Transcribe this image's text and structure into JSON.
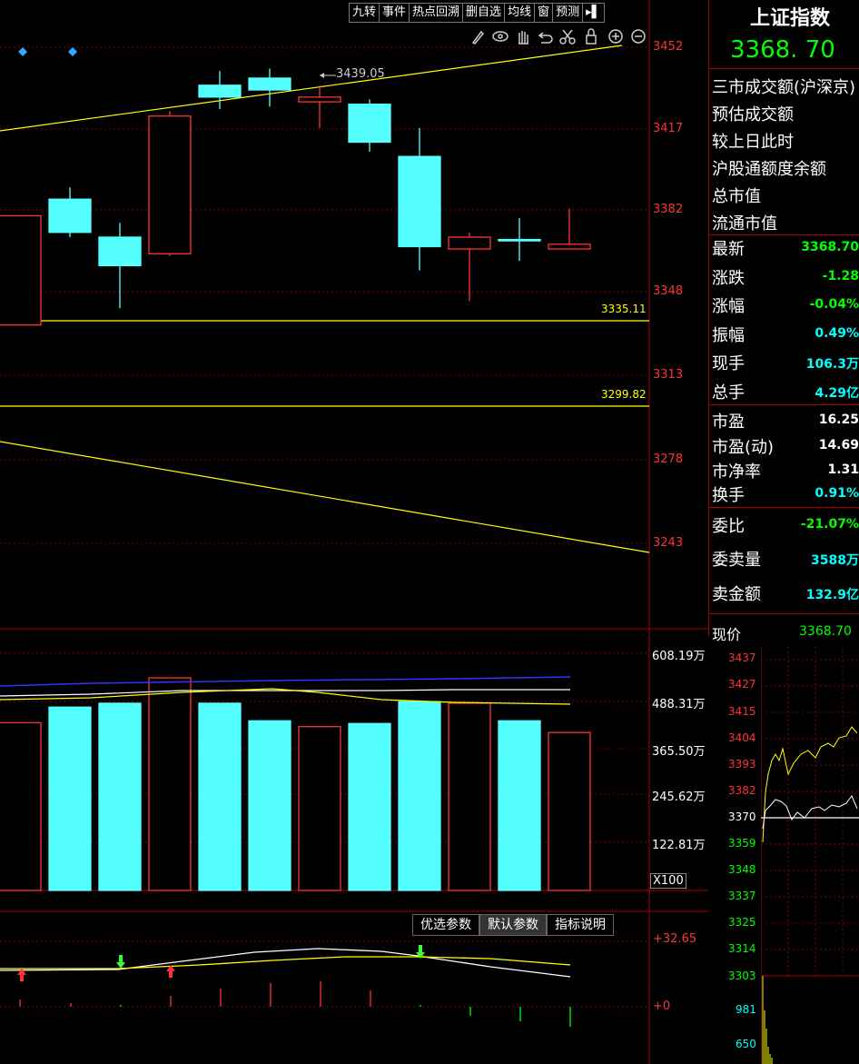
{
  "toolbar": {
    "items": [
      "九转",
      "事件",
      "热点回溯",
      "删自选",
      "均线",
      "窗",
      "预测"
    ],
    "exit_icon": "exit-arrow-icon"
  },
  "chart_tools": [
    "pencil-icon",
    "eye-icon",
    "hand-icon",
    "undo-icon",
    "scissors-icon",
    "lock-icon",
    "zoom-in-icon",
    "zoom-out-icon"
  ],
  "kline": {
    "price_axis": [
      "3452",
      "3417",
      "3382",
      "3348",
      "3313",
      "3278",
      "3243"
    ],
    "high_marker": "3439.05",
    "support_1": "3335.11",
    "support_2": "3299.82",
    "colors": {
      "up": "#ff3333",
      "down": "#55ffff",
      "trend": "#ffff00"
    },
    "candles": [
      {
        "o": 3335,
        "c": 3381,
        "h": 3381,
        "l": 3335,
        "dir": "up"
      },
      {
        "o": 3388,
        "c": 3374,
        "h": 3393,
        "l": 3372,
        "dir": "down"
      },
      {
        "o": 3372,
        "c": 3360,
        "h": 3378,
        "l": 3342,
        "dir": "down"
      },
      {
        "o": 3365,
        "c": 3423,
        "h": 3425,
        "l": 3364,
        "dir": "up"
      },
      {
        "o": 3436,
        "c": 3431,
        "h": 3442,
        "l": 3426,
        "dir": "down"
      },
      {
        "o": 3439,
        "c": 3434,
        "h": 3443,
        "l": 3427,
        "dir": "down"
      },
      {
        "o": 3429,
        "c": 3431,
        "h": 3436,
        "l": 3418,
        "dir": "up"
      },
      {
        "o": 3428,
        "c": 3412,
        "h": 3430,
        "l": 3408,
        "dir": "down"
      },
      {
        "o": 3406,
        "c": 3368,
        "h": 3418,
        "l": 3358,
        "dir": "down"
      },
      {
        "o": 3367,
        "c": 3372,
        "h": 3374,
        "l": 3345,
        "dir": "up"
      },
      {
        "o": 3371,
        "c": 3371,
        "h": 3380,
        "l": 3362,
        "dir": "down"
      },
      {
        "o": 3367,
        "c": 3369,
        "h": 3384,
        "l": 3367,
        "dir": "up"
      }
    ]
  },
  "volume": {
    "axis": [
      "608.19万",
      "488.31万",
      "365.50万",
      "245.62万",
      "122.81万"
    ],
    "multiplier": "X100",
    "bars": [
      {
        "v": 430,
        "dir": "up"
      },
      {
        "v": 470,
        "dir": "down"
      },
      {
        "v": 480,
        "dir": "down"
      },
      {
        "v": 545,
        "dir": "up"
      },
      {
        "v": 480,
        "dir": "down"
      },
      {
        "v": 435,
        "dir": "down"
      },
      {
        "v": 420,
        "dir": "up"
      },
      {
        "v": 428,
        "dir": "down"
      },
      {
        "v": 484,
        "dir": "down"
      },
      {
        "v": 480,
        "dir": "up"
      },
      {
        "v": 435,
        "dir": "down"
      },
      {
        "v": 405,
        "dir": "up"
      }
    ]
  },
  "indicator": {
    "buttons": [
      "优选参数",
      "默认参数",
      "指标说明"
    ],
    "axis_top": "+32.65",
    "axis_zero": "+0"
  },
  "quote": {
    "name": "上证指数",
    "price": "3368. 70",
    "info_rows": [
      "三市成交额(沪深京)",
      "预估成交额",
      "较上日此时",
      "沪股通额度余额",
      "总市值",
      "流通市值"
    ],
    "stats": [
      {
        "label": "最新",
        "value": "3368.70",
        "color": "green"
      },
      {
        "label": "涨跌",
        "value": "-1.28",
        "color": "green"
      },
      {
        "label": "涨幅",
        "value": "-0.04%",
        "color": "green"
      },
      {
        "label": "振幅",
        "value": "0.49%",
        "color": "cyan"
      },
      {
        "label": "现手",
        "value": "106.3万",
        "color": "cyan"
      },
      {
        "label": "总手",
        "value": "4.29亿",
        "color": "cyan"
      },
      {
        "label": "市盈",
        "value": "16.25",
        "color": "white"
      },
      {
        "label": "市盈(动)",
        "value": "14.69",
        "color": "white"
      },
      {
        "label": "市净率",
        "value": "1.31",
        "color": "white"
      },
      {
        "label": "换手",
        "value": "0.91%",
        "color": "cyan"
      },
      {
        "label": "委比",
        "value": "-21.07%",
        "color": "green"
      },
      {
        "label": "委卖量",
        "value": "3588万",
        "color": "cyan"
      },
      {
        "label": "卖金额",
        "value": "132.9亿",
        "color": "cyan"
      }
    ],
    "current_label": "现价",
    "current_value": "3368.70",
    "mini_axis": [
      "3437",
      "3427",
      "3415",
      "3404",
      "3393",
      "3382",
      "3370",
      "3359",
      "3348",
      "3337",
      "3325",
      "3314",
      "3303"
    ],
    "mini_vol_axis": [
      "981",
      "650"
    ]
  }
}
